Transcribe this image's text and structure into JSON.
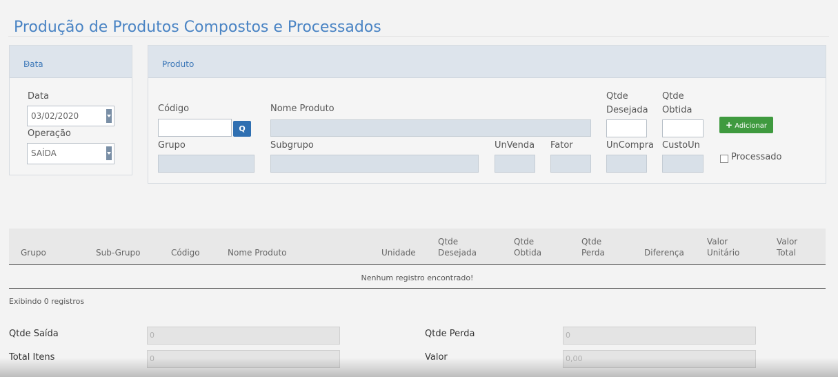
{
  "page_title": "Produção de Produtos Compostos e Processados",
  "data_panel": {
    "header": "Data",
    "data_label": "Data",
    "data_value": "03/02/2020",
    "operacao_label": "Operação",
    "operacao_value": "SAÍDA"
  },
  "produto_panel": {
    "header": "Produto",
    "codigo_label": "Código",
    "nome_produto_label": "Nome Produto",
    "qtde_desejada_label_1": "Qtde",
    "qtde_desejada_label_2": "Desejada",
    "qtde_obtida_label_1": "Qtde",
    "qtde_obtida_label_2": "Obtida",
    "add_button": "Adicionar",
    "add_icon": "plus-icon",
    "search_icon": "search-icon",
    "grupo_label": "Grupo",
    "subgrupo_label": "Subgrupo",
    "unvenda_label": "UnVenda",
    "fator_label": "Fator",
    "uncompra_label": "UnCompra",
    "custoun_label": "CustoUn",
    "processado_label": "Processado",
    "processado_checked": false
  },
  "table": {
    "columns": [
      {
        "l1": "",
        "l2": "Grupo"
      },
      {
        "l1": "",
        "l2": "Sub-Grupo"
      },
      {
        "l1": "",
        "l2": "Código"
      },
      {
        "l1": "",
        "l2": "Nome Produto"
      },
      {
        "l1": "",
        "l2": "Unidade"
      },
      {
        "l1": "Qtde",
        "l2": "Desejada"
      },
      {
        "l1": "Qtde",
        "l2": "Obtida"
      },
      {
        "l1": "Qtde",
        "l2": "Perda"
      },
      {
        "l1": "",
        "l2": "Diferença"
      },
      {
        "l1": "Valor",
        "l2": "Unitário"
      },
      {
        "l1": "Valor",
        "l2": "Total"
      }
    ],
    "empty_message": "Nenhum registro encontrado!",
    "count_text": "Exibindo 0 registros"
  },
  "summary": {
    "qtde_saida_label": "Qtde Saída",
    "qtde_saida_value": "0",
    "total_itens_label": "Total Itens",
    "total_itens_value": "0",
    "qtde_perda_label": "Qtde Perda",
    "qtde_perda_value": "0",
    "valor_label": "Valor",
    "valor_value": "0,00"
  },
  "colors": {
    "accent": "#4a84c4",
    "panel_header": "#dde4ec",
    "add_button": "#3f9a3f",
    "search_button": "#2f6fb1"
  }
}
